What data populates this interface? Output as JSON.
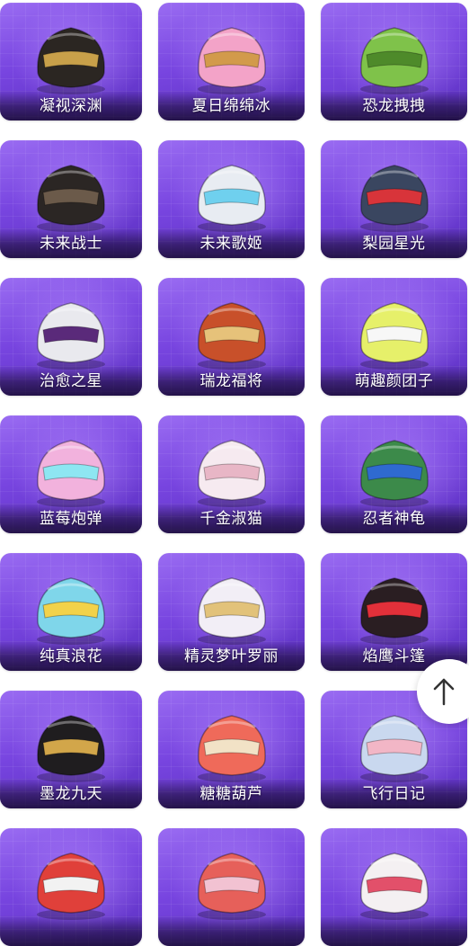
{
  "items": [
    {
      "label": "凝视深渊",
      "icon": "dark-antler-helmet-icon",
      "c1": "#2b2622",
      "c2": "#c8a04a"
    },
    {
      "label": "夏日绵绵冰",
      "icon": "ice-cream-helmet-icon",
      "c1": "#f3a3c8",
      "c2": "#d29a4b"
    },
    {
      "label": "恐龙拽拽",
      "icon": "dinosaur-helmet-icon",
      "c1": "#7fc24a",
      "c2": "#4e8a2a"
    },
    {
      "label": "未来战士",
      "icon": "spiked-black-helmet-icon",
      "c1": "#2b2624",
      "c2": "#6b5a4a"
    },
    {
      "label": "未来歌姬",
      "icon": "white-visor-helmet-icon",
      "c1": "#e8ecf2",
      "c2": "#6fd0ee"
    },
    {
      "label": "梨园星光",
      "icon": "opera-headdress-helmet-icon",
      "c1": "#3a4660",
      "c2": "#d8343a"
    },
    {
      "label": "治愈之星",
      "icon": "motorcycle-helmet-icon",
      "c1": "#e9e9ee",
      "c2": "#5a2a7a"
    },
    {
      "label": "瑞龙福将",
      "icon": "dragon-red-helmet-icon",
      "c1": "#c8502a",
      "c2": "#e6c27a"
    },
    {
      "label": "萌趣颜团子",
      "icon": "sprout-yellow-helmet-icon",
      "c1": "#e6f06a",
      "c2": "#f7f7f7"
    },
    {
      "label": "蓝莓炮弹",
      "icon": "pink-cake-helmet-icon",
      "c1": "#f2b2dd",
      "c2": "#8ee6f2"
    },
    {
      "label": "千金淑猫",
      "icon": "cat-ear-lace-helmet-icon",
      "c1": "#f6eaf0",
      "c2": "#e8b6c6"
    },
    {
      "label": "忍者神龟",
      "icon": "turtle-armor-helmet-icon",
      "c1": "#3c8a4a",
      "c2": "#2f6ad0"
    },
    {
      "label": "纯真浪花",
      "icon": "wave-duck-helmet-icon",
      "c1": "#7fd6ea",
      "c2": "#f2d24a"
    },
    {
      "label": "精灵梦叶罗丽",
      "icon": "fairy-gold-helmet-icon",
      "c1": "#f2eef6",
      "c2": "#e2c27a"
    },
    {
      "label": "焰鹰斗篷",
      "icon": "red-black-visor-helmet-icon",
      "c1": "#2a1e22",
      "c2": "#e2303a"
    },
    {
      "label": "墨龙九天",
      "icon": "black-dragon-helmet-icon",
      "c1": "#1f1d1f",
      "c2": "#d2a64a"
    },
    {
      "label": "糖糖葫芦",
      "icon": "candy-haw-helmet-icon",
      "c1": "#ef6a5a",
      "c2": "#f2e2c6"
    },
    {
      "label": "飞行日记",
      "icon": "pastel-pilot-helmet-icon",
      "c1": "#c9d8ef",
      "c2": "#f2b6c6"
    },
    {
      "label": "",
      "icon": "red-helmet-partial-icon",
      "c1": "#e0403a",
      "c2": "#f2f2f2"
    },
    {
      "label": "",
      "icon": "red-pink-helmet-partial-icon",
      "c1": "#e6605a",
      "c2": "#f2c2d2"
    },
    {
      "label": "",
      "icon": "white-red-helmet-partial-icon",
      "c1": "#f4f0f2",
      "c2": "#e2506a"
    }
  ],
  "scroll_top": {
    "icon": "arrow-up-icon"
  }
}
